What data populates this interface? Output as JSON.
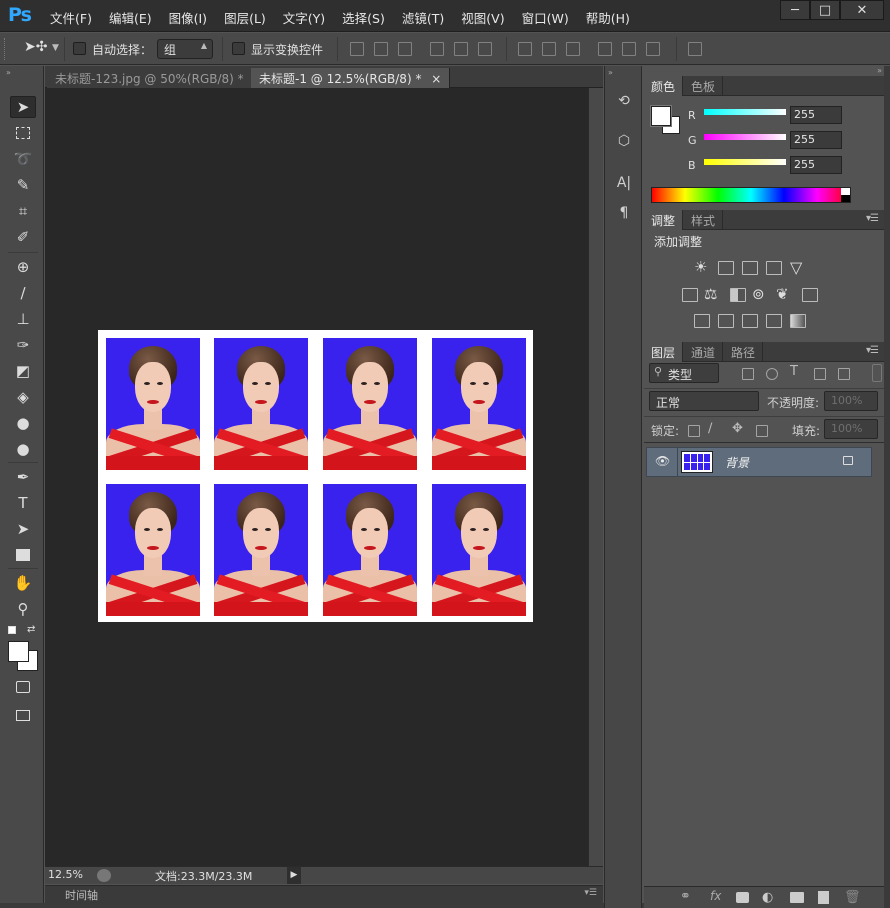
{
  "app": {
    "logo": "Ps",
    "menu": [
      "文件(F)",
      "编辑(E)",
      "图像(I)",
      "图层(L)",
      "文字(Y)",
      "选择(S)",
      "滤镜(T)",
      "视图(V)",
      "窗口(W)",
      "帮助(H)"
    ],
    "window_controls": [
      "─",
      "□",
      "✕"
    ]
  },
  "options": {
    "move_icon": "move-tool-icon",
    "auto_select_label": "自动选择：",
    "auto_select_value": "组",
    "show_transform_label": "显示变换控件"
  },
  "tabs": [
    {
      "label": "未标题-123.jpg @ 50%(RGB/8) *",
      "close": "×",
      "active": false
    },
    {
      "label": "未标题-1 @ 12.5%(RGB/8) *",
      "close": "×",
      "active": true
    }
  ],
  "statusbar": {
    "zoom": "12.5%",
    "doc_size": "文档:23.3M/23.3M"
  },
  "timeline": {
    "label": "时间轴"
  },
  "color_panel": {
    "tabs": [
      "颜色",
      "色板"
    ],
    "channels": [
      {
        "name": "R",
        "value": "255",
        "color": "#00ffff"
      },
      {
        "name": "G",
        "value": "255",
        "color": "#ff00ff"
      },
      {
        "name": "B",
        "value": "255",
        "color": "#ffff00"
      }
    ]
  },
  "adjust_panel": {
    "tabs": [
      "调整",
      "样式"
    ],
    "title": "添加调整"
  },
  "layers_panel": {
    "tabs": [
      "图层",
      "通道",
      "路径"
    ],
    "filter_kind": "类型",
    "blend_mode": "正常",
    "opacity_label": "不透明度:",
    "opacity_value": "100%",
    "lock_label": "锁定:",
    "fill_label": "填充:",
    "fill_value": "100%",
    "layers": [
      {
        "name": "背景",
        "visible": true,
        "locked": true
      }
    ],
    "footer_icons": [
      "link-icon",
      "fx-icon",
      "mask-icon",
      "adjustment-icon",
      "folder-icon",
      "new-layer-icon",
      "trash-icon"
    ]
  },
  "document": {
    "background": "#ffffff",
    "photo_bg": "#3a22ee",
    "photo_count": 8
  }
}
